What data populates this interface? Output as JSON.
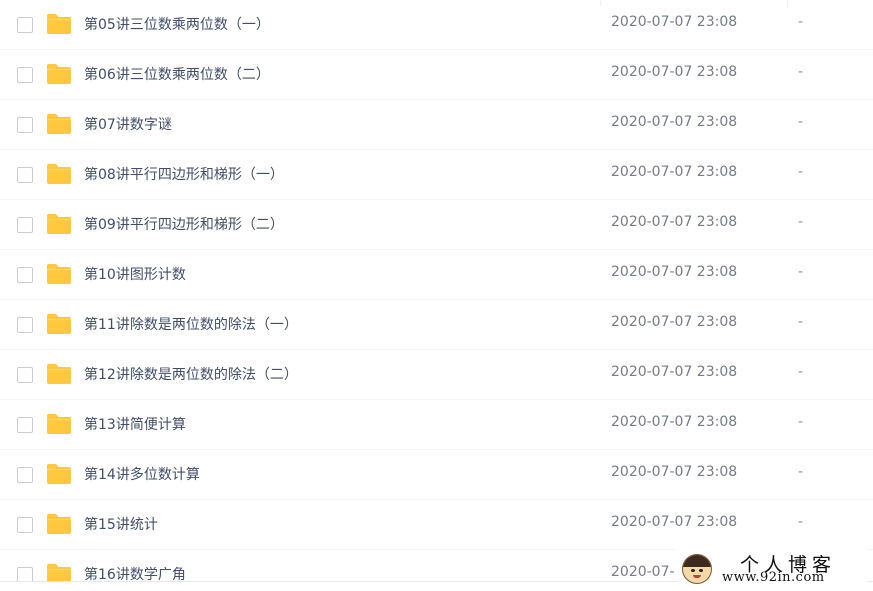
{
  "file_list": {
    "rows": [
      {
        "name": "第05讲三位数乘两位数（一）",
        "date": "2020-07-07 23:08",
        "size": "-"
      },
      {
        "name": "第06讲三位数乘两位数（二）",
        "date": "2020-07-07 23:08",
        "size": "-"
      },
      {
        "name": "第07讲数字谜",
        "date": "2020-07-07 23:08",
        "size": "-"
      },
      {
        "name": "第08讲平行四边形和梯形（一）",
        "date": "2020-07-07 23:08",
        "size": "-"
      },
      {
        "name": "第09讲平行四边形和梯形（二）",
        "date": "2020-07-07 23:08",
        "size": "-"
      },
      {
        "name": "第10讲图形计数",
        "date": "2020-07-07 23:08",
        "size": "-"
      },
      {
        "name": "第11讲除数是两位数的除法（一）",
        "date": "2020-07-07 23:08",
        "size": "-"
      },
      {
        "name": "第12讲除数是两位数的除法（二）",
        "date": "2020-07-07 23:08",
        "size": "-"
      },
      {
        "name": "第13讲简便计算",
        "date": "2020-07-07 23:08",
        "size": "-"
      },
      {
        "name": "第14讲多位数计算",
        "date": "2020-07-07 23:08",
        "size": "-"
      },
      {
        "name": "第15讲统计",
        "date": "2020-07-07 23:08",
        "size": "-"
      },
      {
        "name": "第16讲数学广角",
        "date": "2020-07-",
        "size": ""
      }
    ],
    "icon": "folder-icon",
    "folder_color": "#ffc83d"
  },
  "watermark": {
    "title": "个人博客",
    "url": "www.92in.com"
  }
}
